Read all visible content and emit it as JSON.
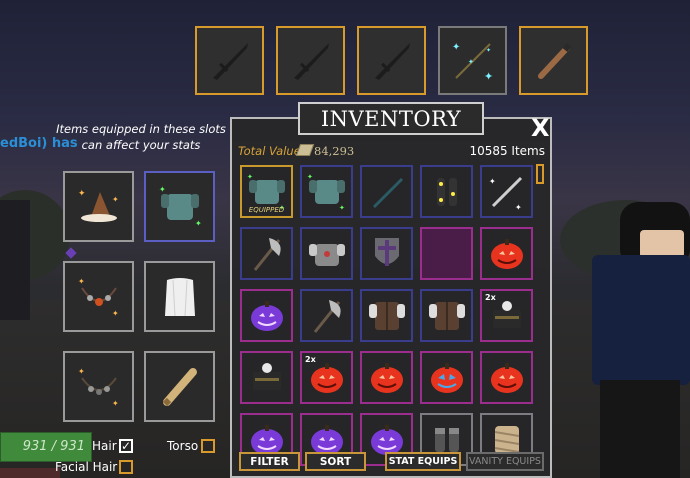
{
  "scene": {
    "player_name": "edBoi) has"
  },
  "hotbar": {
    "slots": [
      {
        "icon": "sword-silhouette-icon",
        "selected": true
      },
      {
        "icon": "sword-silhouette-icon",
        "selected": true
      },
      {
        "icon": "sword-silhouette-icon",
        "selected": true
      },
      {
        "icon": "sparkle-staff-icon",
        "selected": false
      },
      {
        "icon": "wooden-club-icon",
        "selected": true
      }
    ]
  },
  "equip_panel": {
    "note": "Items equipped in these slots can affect your stats",
    "slots": [
      {
        "icon": "witch-hat-icon"
      },
      {
        "icon": "green-armor-icon"
      },
      {
        "icon": "bead-necklace-icon"
      },
      {
        "icon": "white-robe-icon"
      },
      {
        "icon": "dark-necklace-icon"
      },
      {
        "icon": "scroll-icon"
      }
    ]
  },
  "health": {
    "text": "931 / 931"
  },
  "toggles": [
    {
      "label": "Hair",
      "checked": true
    },
    {
      "label": "Torso",
      "checked": false
    },
    {
      "label": "Facial Hair",
      "checked": false
    }
  ],
  "inventory": {
    "title": "INVENTORY",
    "close": "X",
    "total_value_label": "Total Value",
    "total_value": "84,293",
    "item_count": "10585 Items",
    "equipped_tag": "EQUIPPED",
    "items": [
      {
        "icon": "green-armor-icon",
        "border": "gold",
        "equipped": true
      },
      {
        "icon": "green-armor-icon",
        "border": "blue"
      },
      {
        "icon": "teal-blade-icon",
        "border": "blue"
      },
      {
        "icon": "glowing-gloves-icon",
        "border": "blue"
      },
      {
        "icon": "sparkle-sword-icon",
        "border": "blue"
      },
      {
        "icon": "battle-axe-icon",
        "border": "blue"
      },
      {
        "icon": "steel-armor-icon",
        "border": "blue"
      },
      {
        "icon": "cross-shield-icon",
        "border": "blue"
      },
      {
        "icon": "empty-slot",
        "border": "empty"
      },
      {
        "icon": "red-pumpkin-icon",
        "border": "pink"
      },
      {
        "icon": "purple-pumpkin-icon",
        "border": "pink"
      },
      {
        "icon": "battle-axe-icon",
        "border": "blue"
      },
      {
        "icon": "leather-vest-icon",
        "border": "blue"
      },
      {
        "icon": "leather-vest-icon",
        "border": "blue"
      },
      {
        "icon": "skull-chest-icon",
        "border": "pink",
        "mult": "2x"
      },
      {
        "icon": "skull-chest-icon",
        "border": "pink"
      },
      {
        "icon": "red-pumpkin-icon",
        "border": "pink",
        "mult": "2x"
      },
      {
        "icon": "red-pumpkin-icon",
        "border": "pink"
      },
      {
        "icon": "blue-face-pumpkin-icon",
        "border": "pink"
      },
      {
        "icon": "red-pumpkin-icon",
        "border": "pink"
      },
      {
        "icon": "purple-pumpkin-icon",
        "border": "pink"
      },
      {
        "icon": "purple-pumpkin-icon",
        "border": "pink"
      },
      {
        "icon": "purple-pumpkin-icon",
        "border": "pink"
      },
      {
        "icon": "dark-gloves-icon",
        "border": "gray"
      },
      {
        "icon": "mummy-wrap-icon",
        "border": "gray"
      }
    ],
    "buttons": {
      "filter": "FILTER",
      "sort": "SORT",
      "stat_equips": "STAT EQUIPS",
      "vanity_equips": "VANITY EQUIPS"
    }
  }
}
